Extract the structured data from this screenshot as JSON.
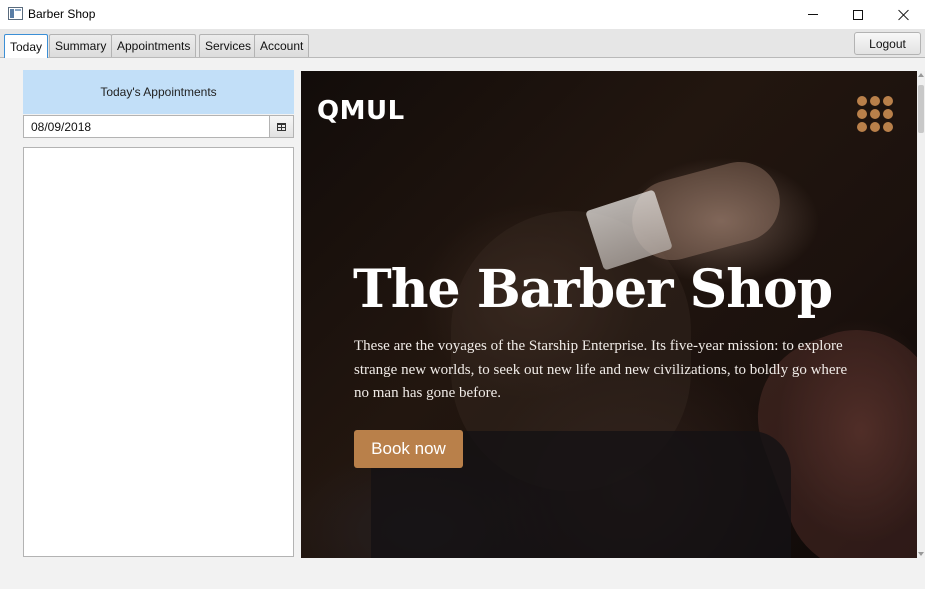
{
  "window": {
    "title": "Barber Shop",
    "app_icon": "window-app-icon",
    "controls": [
      "minimize-icon",
      "maximize-icon",
      "close-icon"
    ]
  },
  "tabs": [
    {
      "label": "Today",
      "active": true
    },
    {
      "label": "Summary",
      "active": false
    },
    {
      "label": "Appointments",
      "active": false
    },
    {
      "label": "Services",
      "active": false
    },
    {
      "label": "Account",
      "active": false
    }
  ],
  "logout_label": "Logout",
  "today": {
    "header": "Today's Appointments",
    "date": "08/09/2018",
    "calendar_icon": "calendar-icon",
    "appointments": []
  },
  "hero": {
    "logo": "QMUL",
    "menu_icon": "apps-grid-icon",
    "title": "The Barber Shop",
    "text": "These are the voyages of the Starship Enterprise. Its five-year mission: to explore strange new worlds, to seek out new life and new civilizations, to boldly go where no man has gone before.",
    "button": "Book now"
  },
  "colors": {
    "accent": "#b9804a",
    "header_bg": "#c2dff8",
    "active_tab_border": "#3b8fd6"
  }
}
